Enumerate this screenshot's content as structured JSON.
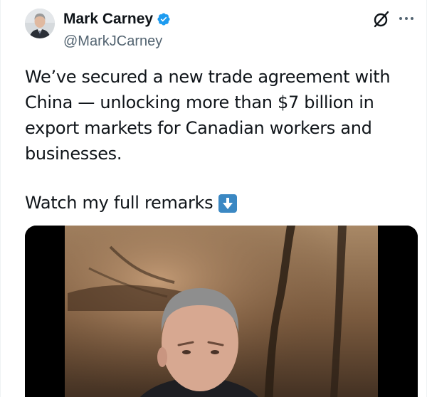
{
  "author": {
    "display_name": "Mark Carney",
    "handle": "@MarkJCarney",
    "verified": true,
    "verified_color": "#1d9bf0"
  },
  "actions": {
    "grok_icon": "grok-icon",
    "more_icon": "more-horizontal-icon"
  },
  "tweet": {
    "text_paragraph": "We’ve secured a new trade agreement with China — unlocking more than $7 billion in export markets for Canadian workers and businesses.",
    "watch_line": "Watch my full remarks",
    "watch_emoji": "down-arrow-icon"
  },
  "media": {
    "type": "video",
    "description_icon": "video-thumbnail"
  }
}
